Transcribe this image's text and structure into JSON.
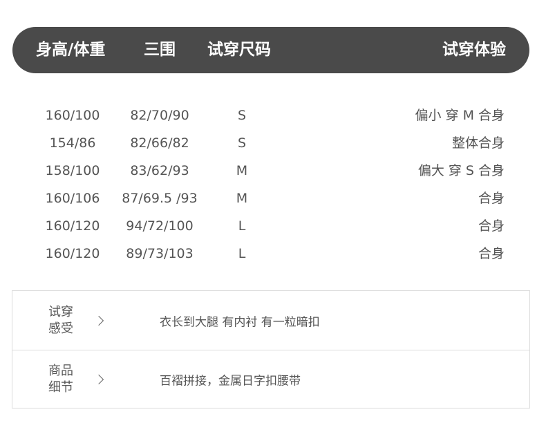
{
  "header": {
    "height_weight": "身高/体重",
    "measurements": "三围",
    "size": "试穿尺码",
    "experience": "试穿体验"
  },
  "rows": [
    {
      "height_weight": "160/100",
      "measurements": "82/70/90",
      "size": "S",
      "feel": "偏小 穿 M 合身"
    },
    {
      "height_weight": "154/86",
      "measurements": "82/66/82",
      "size": "S",
      "feel": "整体合身"
    },
    {
      "height_weight": "158/100",
      "measurements": "83/62/93",
      "size": "M",
      "feel": "偏大 穿 S 合身"
    },
    {
      "height_weight": "160/106",
      "measurements": "87/69.5 /93",
      "size": "M",
      "feel": "合身"
    },
    {
      "height_weight": "160/120",
      "measurements": "94/72/100",
      "size": "L",
      "feel": "合身"
    },
    {
      "height_weight": "160/120",
      "measurements": "89/73/103",
      "size": "L",
      "feel": "合身"
    }
  ],
  "sections": [
    {
      "label_line1": "试穿",
      "label_line2": "感受",
      "text": "衣长到大腿 有内衬 有一粒暗扣"
    },
    {
      "label_line1": "商品",
      "label_line2": "细节",
      "text": "百褶拼接，金属日字扣腰带"
    }
  ],
  "colors": {
    "header_bg": "#4a4a4a",
    "text": "#555555",
    "border": "#dcdcdc"
  }
}
